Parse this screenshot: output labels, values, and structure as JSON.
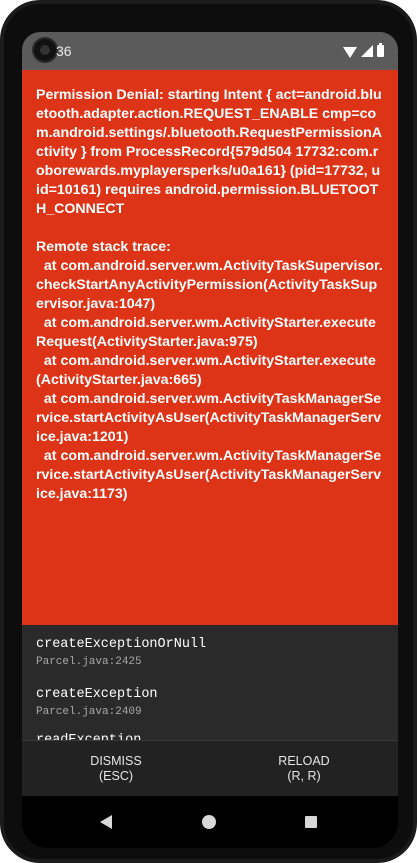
{
  "status_bar": {
    "time": "36"
  },
  "error": {
    "message": "Permission Denial: starting Intent { act=android.bluetooth.adapter.action.REQUEST_ENABLE cmp=com.android.settings/.bluetooth.RequestPermissionActivity } from ProcessRecord{579d504 17732:com.roborewards.myplayersperks/u0a161} (pid=17732, uid=10161) requires android.permission.BLUETOOTH_CONNECT\n\nRemote stack trace:\n  at com.android.server.wm.ActivityTaskSupervisor.checkStartAnyActivityPermission(ActivityTaskSupervisor.java:1047)\n  at com.android.server.wm.ActivityStarter.executeRequest(ActivityStarter.java:975)\n  at com.android.server.wm.ActivityStarter.execute(ActivityStarter.java:665)\n  at com.android.server.wm.ActivityTaskManagerService.startActivityAsUser(ActivityTaskManagerService.java:1201)\n  at com.android.server.wm.ActivityTaskManagerService.startActivityAsUser(ActivityTaskManagerService.java:1173)"
  },
  "stack": {
    "frames": [
      {
        "function": "createExceptionOrNull",
        "location": "Parcel.java:2425"
      },
      {
        "function": "createException",
        "location": "Parcel.java:2409"
      },
      {
        "function": "readException",
        "location": ""
      }
    ]
  },
  "actions": {
    "dismiss": {
      "label": "DISMISS",
      "shortcut": "(ESC)"
    },
    "reload": {
      "label": "RELOAD",
      "shortcut": "(R, R)"
    }
  },
  "icons": {
    "status": [
      "wifi-icon",
      "cell-signal-icon",
      "battery-icon"
    ],
    "nav": [
      "back-icon",
      "home-icon",
      "recents-icon"
    ]
  },
  "colors": {
    "error_background": "#dd3418",
    "stack_background": "#2a2a2a",
    "status_bar": "#5b5b5b"
  }
}
